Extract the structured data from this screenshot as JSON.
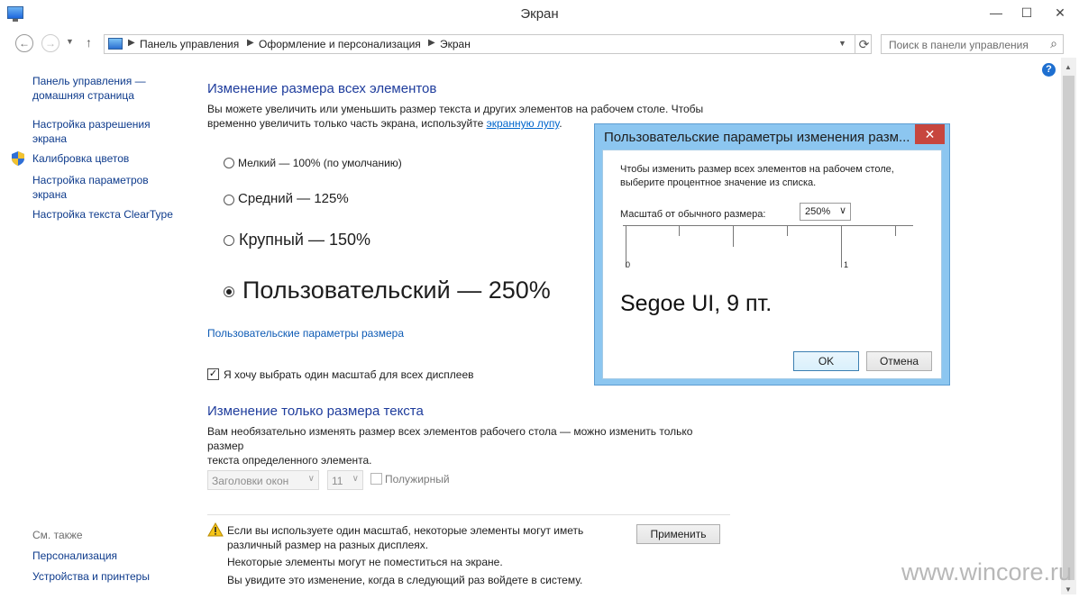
{
  "window": {
    "title": "Экран",
    "minimize": "—",
    "maximize": "☐",
    "close": "✕"
  },
  "address": {
    "crumbs": [
      "Панель управления",
      "Оформление и персонализация",
      "Экран"
    ],
    "search_placeholder": "Поиск в панели управления"
  },
  "help_label": "?",
  "sidebar": {
    "links": [
      "Панель управления —",
      "домашняя страница",
      "Настройка разрешения",
      "экрана",
      "Калибровка цветов",
      "Настройка параметров",
      "экрана",
      "Настройка текста ClearType"
    ],
    "see_also": "См. также",
    "see_also_links": [
      "Персонализация",
      "Устройства и принтеры"
    ]
  },
  "main": {
    "section1_title": "Изменение размера всех элементов",
    "section1_desc_line1": "Вы можете увеличить или уменьшить размер текста и других элементов на рабочем столе. Чтобы",
    "section1_desc_line2": "временно увеличить только часть экрана, используйте ",
    "section1_desc_link": "экранную лупу",
    "section1_desc_end": ".",
    "options": [
      {
        "label": "Мелкий — 100% (по умолчанию)",
        "selected": false
      },
      {
        "label": "Средний — 125%",
        "selected": false
      },
      {
        "label": "Крупный — 150%",
        "selected": false
      },
      {
        "label": "Пользовательский — 250%",
        "selected": true
      }
    ],
    "custom_size_link": "Пользовательские параметры размера",
    "one_scale_checkbox": {
      "label": "Я хочу выбрать один масштаб для всех дисплеев",
      "checked": true,
      "mark": "✓"
    },
    "section2_title": "Изменение только размера текста",
    "section2_desc_line1": "Вам необязательно изменять размер всех элементов рабочего стола — можно изменить только размер",
    "section2_desc_line2": "текста определенного элемента.",
    "element_select": "Заголовки окон",
    "size_select": "11",
    "bold_label": "Полужирный",
    "warning_lines": [
      "Если вы используете один масштаб, некоторые элементы могут иметь",
      "различный размер на разных дисплеях.",
      "Некоторые элементы могут не поместиться на экране.",
      "Вы увидите это изменение, когда в следующий раз войдете в систему."
    ],
    "apply_button": "Применить"
  },
  "dialog": {
    "title": "Пользовательские параметры изменения разм...",
    "close": "✕",
    "text_line1": "Чтобы изменить размер всех элементов на рабочем столе,",
    "text_line2": "выберите процентное значение из списка.",
    "scale_label": "Масштаб от обычного размера:",
    "scale_value": "250%",
    "ruler_start": "0",
    "ruler_end": "1",
    "sample_text": "Segoe UI, 9 пт.",
    "ok_button": "OK",
    "cancel_button": "Отмена"
  },
  "watermark": "www.wincore.ru"
}
